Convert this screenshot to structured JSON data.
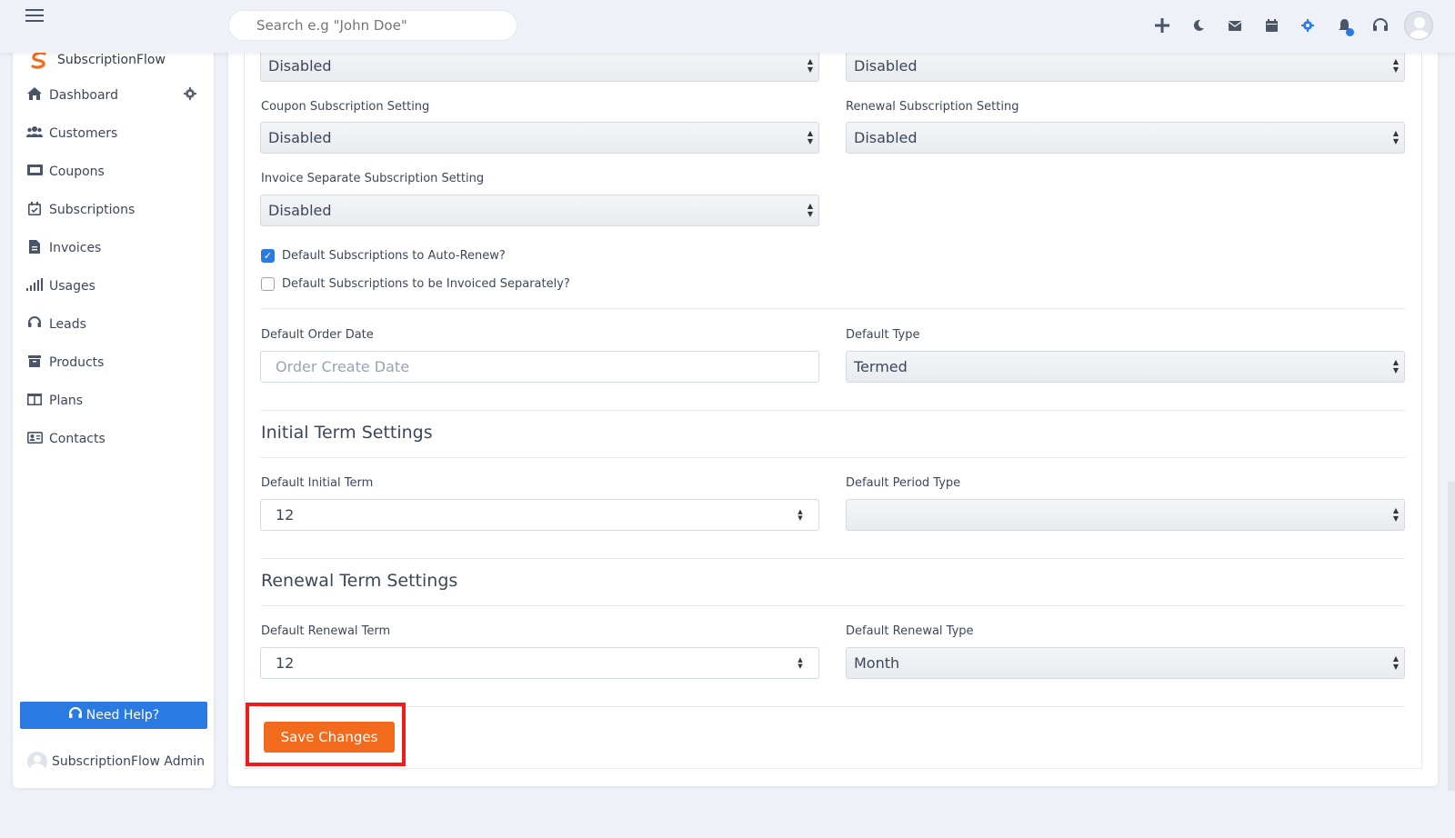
{
  "topbar": {
    "search_placeholder": "Search e.g \"John Doe\"",
    "icons": [
      "plus-icon",
      "moon-icon",
      "mail-icon",
      "calendar-icon",
      "gear-icon",
      "bell-icon",
      "headset-icon",
      "user-avatar"
    ]
  },
  "sidebar": {
    "brand": "SubscriptionFlow",
    "items": [
      {
        "label": "Dashboard",
        "icon": "home-icon"
      },
      {
        "label": "Customers",
        "icon": "users-icon"
      },
      {
        "label": "Coupons",
        "icon": "ticket-icon"
      },
      {
        "label": "Subscriptions",
        "icon": "calendar-check-icon"
      },
      {
        "label": "Invoices",
        "icon": "invoice-icon"
      },
      {
        "label": "Usages",
        "icon": "signal-bars-icon"
      },
      {
        "label": "Leads",
        "icon": "headset-icon"
      },
      {
        "label": "Products",
        "icon": "box-icon"
      },
      {
        "label": "Plans",
        "icon": "columns-icon"
      },
      {
        "label": "Contacts",
        "icon": "contact-card-icon"
      }
    ],
    "help_button": "Need Help?",
    "user_name": "SubscriptionFlow Admin"
  },
  "form": {
    "top_left_select": "Disabled",
    "top_right_select": "Disabled",
    "coupon_label": "Coupon Subscription Setting",
    "coupon_value": "Disabled",
    "renewal_label": "Renewal Subscription Setting",
    "renewal_value": "Disabled",
    "invoice_sep_label": "Invoice Separate Subscription Setting",
    "invoice_sep_value": "Disabled",
    "auto_renew_label": "Default Subscriptions to Auto-Renew?",
    "auto_renew_checked": true,
    "invoiced_sep_label": "Default Subscriptions to be Invoiced Separately?",
    "invoiced_sep_checked": false,
    "order_date_label": "Default Order Date",
    "order_date_placeholder": "Order Create Date",
    "default_type_label": "Default Type",
    "default_type_value": "Termed",
    "initial_term_title": "Initial Term Settings",
    "initial_term_label": "Default Initial Term",
    "initial_term_value": "12",
    "period_type_label": "Default Period Type",
    "period_type_value": "",
    "renewal_term_title": "Renewal Term Settings",
    "renewal_term_label": "Default Renewal Term",
    "renewal_term_value": "12",
    "renewal_type_label": "Default Renewal Type",
    "renewal_type_value": "Month",
    "save_button": "Save Changes"
  },
  "colors": {
    "accent": "#2a7ae2",
    "save": "#f26a1b",
    "highlight": "#f01c1c"
  }
}
